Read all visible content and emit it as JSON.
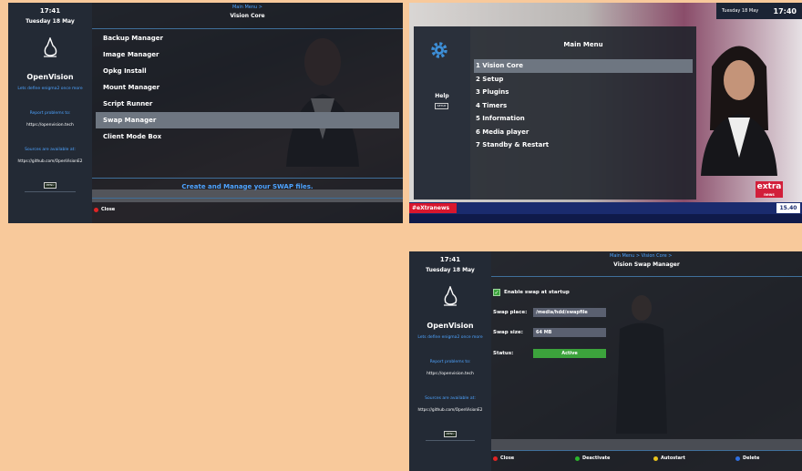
{
  "sidebar": {
    "time": "17:41",
    "date": "Tuesday 18 May",
    "brand": "OpenVision",
    "tagline": "Lets define enigma2 once more",
    "report_label": "Report problems to:",
    "report_url": "https://openvision.tech",
    "sources_label": "Sources are available at:",
    "sources_url": "https://github.com/OpenVisionE2",
    "key_label": "MENU"
  },
  "vision_core": {
    "breadcrumb": "Main Menu >",
    "title": "Vision Core",
    "items": [
      "Backup Manager",
      "Image Manager",
      "Opkg Install",
      "Mount Manager",
      "Script Runner",
      "Swap Manager",
      "Client Mode Box"
    ],
    "selected_index": 5,
    "description": "Create and Manage your SWAP files.",
    "footer_close": "Close"
  },
  "main_menu": {
    "title": "Main Menu",
    "help_label": "Help",
    "help_key": "SETUP",
    "items": [
      "1 Vision Core",
      "2 Setup",
      "3 Plugins",
      "4 Timers",
      "5 Information",
      "6 Media player",
      "7 Standby & Restart"
    ],
    "selected_index": 0,
    "clock_date": "Tuesday 18 May",
    "clock_time": "17:40",
    "channel_logo": "extra",
    "channel_logo_sub": "news",
    "ticker_time": "15.40",
    "ticker_hashtag": "#eXtranews"
  },
  "swap_manager": {
    "breadcrumb": "Main Menu > Vision Core >",
    "title": "Vision Swap Manager",
    "enable_label": "Enable swap at startup",
    "place_label": "Swap place:",
    "place_value": "/media/hdd/swapfile",
    "size_label": "Swap size:",
    "size_value": "64 MB",
    "status_label": "Status:",
    "status_value": "Active",
    "btn_close": "Close",
    "btn_deactivate": "Deactivate",
    "btn_autostart": "Autostart",
    "btn_delete": "Delete"
  },
  "colors": {
    "accent": "#4da3ff",
    "selection": "#6e7681",
    "status_active": "#3ca33c",
    "red": "#e02424",
    "green": "#2bb52b",
    "yellow": "#e8c21c",
    "blue": "#2f6fe0"
  }
}
